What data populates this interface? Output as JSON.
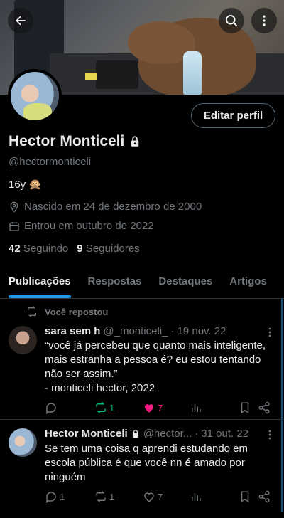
{
  "header": {
    "back_icon": "arrow-left-icon",
    "search_icon": "search-icon",
    "more_icon": "more-vertical-icon"
  },
  "profile": {
    "edit_button": "Editar perfil",
    "display_name": "Hector Monticeli",
    "lock_icon": "lock-icon",
    "handle": "@hectormonticeli",
    "bio": "16y 🙊",
    "born": "Nascido em 24 de dezembro de 2000",
    "joined": "Entrou em outubro de 2022",
    "following_count": "42",
    "following_label": "Seguindo",
    "followers_count": "9",
    "followers_label": "Seguidores"
  },
  "tabs": [
    {
      "label": "Publicações",
      "active": true
    },
    {
      "label": "Respostas",
      "active": false
    },
    {
      "label": "Destaques",
      "active": false
    },
    {
      "label": "Artigos",
      "active": false
    }
  ],
  "posts": [
    {
      "repost_label": "Você repostou",
      "name": "sara sem h",
      "handle": "@_monticeli_",
      "dot": "·",
      "date": "19 nov. 22",
      "text": "“você já percebeu que quanto mais inteligente, mais estranha a pessoa é? eu estou tentando não ser assim.”\n- monticeli hector, 2022",
      "replies": "",
      "reposts": "1",
      "likes": "7",
      "views": ""
    },
    {
      "name": "Hector Monticeli",
      "handle": "@hector...",
      "dot": "·",
      "date": "31 out. 22",
      "text": "Se tem uma coisa q aprendi estudando em escola pública é que você nn é amado por ninguém",
      "replies": "1",
      "reposts": "1",
      "likes": "7",
      "views": ""
    }
  ],
  "colors": {
    "accent": "#1d9bf0",
    "repost_green": "#00ba7c",
    "like_pink": "#f91880",
    "muted": "#71767b"
  }
}
